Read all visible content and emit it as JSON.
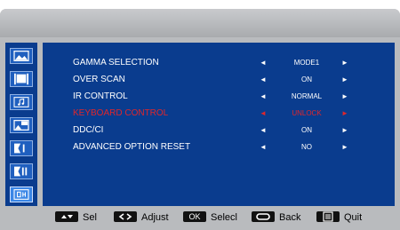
{
  "menu": {
    "items": [
      {
        "label": "GAMMA SELECTION",
        "value": "MODE1"
      },
      {
        "label": "OVER  SCAN",
        "value": "ON"
      },
      {
        "label": "IR CONTROL",
        "value": "NORMAL"
      },
      {
        "label": "KEYBOARD CONTROL",
        "value": "UNLOCK",
        "highlighted": true
      },
      {
        "label": "DDC/CI",
        "value": "ON"
      },
      {
        "label": "ADVANCED OPTION RESET",
        "value": "NO"
      }
    ],
    "left_arrow": "◄",
    "right_arrow": "►"
  },
  "sidebar": {
    "icons": [
      "picture-icon",
      "screen-icon",
      "audio-icon",
      "pip-icon",
      "configuration-one-icon",
      "configuration-two-icon",
      "advanced-option-icon"
    ],
    "active_index": 6
  },
  "footer": {
    "sel_label": "Sel",
    "adjust_label": "Adjust",
    "ok_key": "OK",
    "select_label": "Selecl",
    "back_label": "Back",
    "quit_label": "Quit"
  },
  "colors": {
    "panel": "#0a3c8e",
    "highlight_text": "#e0262b",
    "frame": "#b9bbbe"
  }
}
